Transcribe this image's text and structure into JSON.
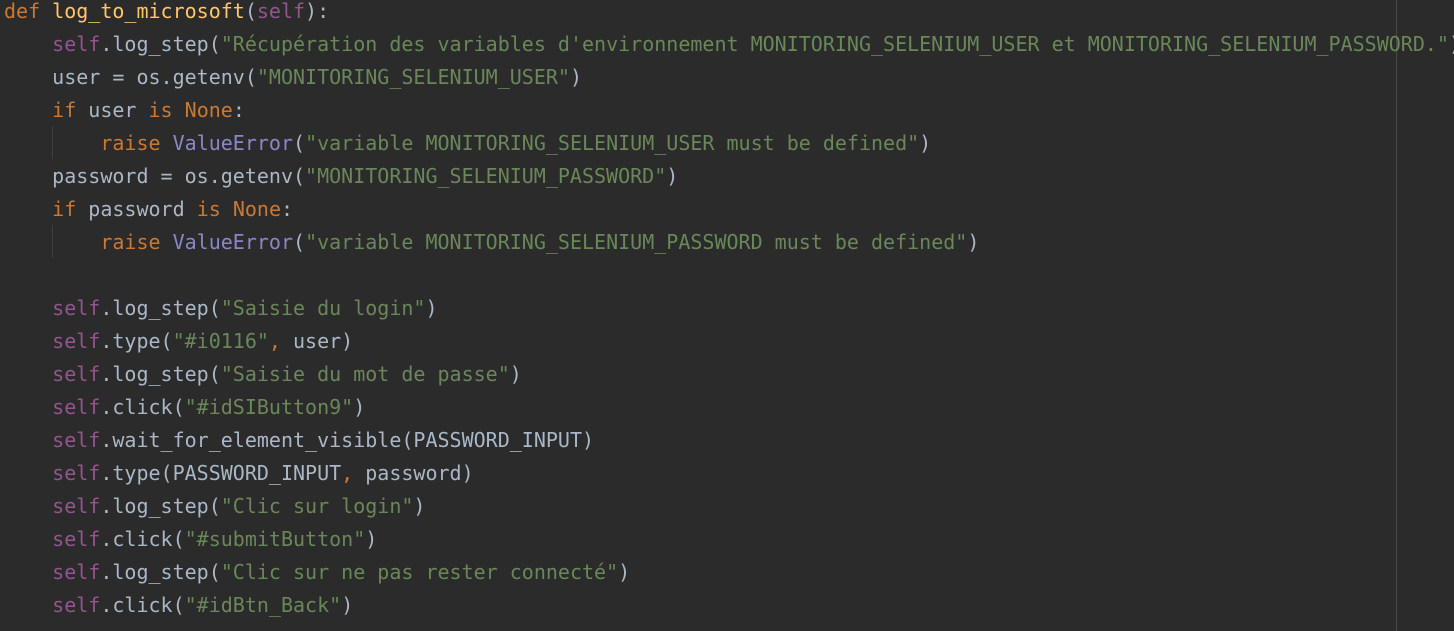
{
  "editor": {
    "language": "python",
    "colors": {
      "background": "#2b2b2b",
      "plain": "#a9b7c6",
      "keyword": "#cc7832",
      "function_name": "#ffc66d",
      "self": "#94558d",
      "string": "#6a8759",
      "builtin": "#8888c6"
    },
    "lines": [
      [
        {
          "t": "def",
          "c": "kw"
        },
        {
          "t": " ",
          "c": "plain"
        },
        {
          "t": "log_to_microsoft",
          "c": "fn"
        },
        {
          "t": "(",
          "c": "plain"
        },
        {
          "t": "self",
          "c": "self"
        },
        {
          "t": "):",
          "c": "plain"
        }
      ],
      [
        {
          "t": "    ",
          "c": "plain"
        },
        {
          "t": "self",
          "c": "self"
        },
        {
          "t": ".log_step(",
          "c": "plain"
        },
        {
          "t": "\"Récupération des variables d'environnement MONITORING_SELENIUM_USER et MONITORING_SELENIUM_PASSWORD.\"",
          "c": "str"
        },
        {
          "t": ")",
          "c": "plain"
        }
      ],
      [
        {
          "t": "    user = os.getenv(",
          "c": "plain"
        },
        {
          "t": "\"MONITORING_SELENIUM_USER\"",
          "c": "str"
        },
        {
          "t": ")",
          "c": "plain"
        }
      ],
      [
        {
          "t": "    ",
          "c": "plain"
        },
        {
          "t": "if",
          "c": "kw"
        },
        {
          "t": " user ",
          "c": "plain"
        },
        {
          "t": "is",
          "c": "kw"
        },
        {
          "t": " ",
          "c": "plain"
        },
        {
          "t": "None",
          "c": "kw"
        },
        {
          "t": ":",
          "c": "plain"
        }
      ],
      [
        {
          "t": "        ",
          "c": "plain"
        },
        {
          "t": "raise",
          "c": "kw"
        },
        {
          "t": " ",
          "c": "plain"
        },
        {
          "t": "ValueError",
          "c": "builtin"
        },
        {
          "t": "(",
          "c": "plain"
        },
        {
          "t": "\"variable MONITORING_SELENIUM_USER must be defined\"",
          "c": "str"
        },
        {
          "t": ")",
          "c": "plain"
        }
      ],
      [
        {
          "t": "    password = os.getenv(",
          "c": "plain"
        },
        {
          "t": "\"MONITORING_SELENIUM_PASSWORD\"",
          "c": "str"
        },
        {
          "t": ")",
          "c": "plain"
        }
      ],
      [
        {
          "t": "    ",
          "c": "plain"
        },
        {
          "t": "if",
          "c": "kw"
        },
        {
          "t": " password ",
          "c": "plain"
        },
        {
          "t": "is",
          "c": "kw"
        },
        {
          "t": " ",
          "c": "plain"
        },
        {
          "t": "None",
          "c": "kw"
        },
        {
          "t": ":",
          "c": "plain"
        }
      ],
      [
        {
          "t": "        ",
          "c": "plain"
        },
        {
          "t": "raise",
          "c": "kw"
        },
        {
          "t": " ",
          "c": "plain"
        },
        {
          "t": "ValueError",
          "c": "builtin"
        },
        {
          "t": "(",
          "c": "plain"
        },
        {
          "t": "\"variable MONITORING_SELENIUM_PASSWORD must be defined\"",
          "c": "str"
        },
        {
          "t": ")",
          "c": "plain"
        }
      ],
      [],
      [
        {
          "t": "    ",
          "c": "plain"
        },
        {
          "t": "self",
          "c": "self"
        },
        {
          "t": ".log_step(",
          "c": "plain"
        },
        {
          "t": "\"Saisie du login\"",
          "c": "str"
        },
        {
          "t": ")",
          "c": "plain"
        }
      ],
      [
        {
          "t": "    ",
          "c": "plain"
        },
        {
          "t": "self",
          "c": "self"
        },
        {
          "t": ".type(",
          "c": "plain"
        },
        {
          "t": "\"#i0116\"",
          "c": "str"
        },
        {
          "t": ",",
          "c": "kw"
        },
        {
          "t": " user)",
          "c": "plain"
        }
      ],
      [
        {
          "t": "    ",
          "c": "plain"
        },
        {
          "t": "self",
          "c": "self"
        },
        {
          "t": ".log_step(",
          "c": "plain"
        },
        {
          "t": "\"Saisie du mot de passe\"",
          "c": "str"
        },
        {
          "t": ")",
          "c": "plain"
        }
      ],
      [
        {
          "t": "    ",
          "c": "plain"
        },
        {
          "t": "self",
          "c": "self"
        },
        {
          "t": ".click(",
          "c": "plain"
        },
        {
          "t": "\"#idSIButton9\"",
          "c": "str"
        },
        {
          "t": ")",
          "c": "plain"
        }
      ],
      [
        {
          "t": "    ",
          "c": "plain"
        },
        {
          "t": "self",
          "c": "self"
        },
        {
          "t": ".wait_for_element_visible(PASSWORD_INPUT)",
          "c": "plain"
        }
      ],
      [
        {
          "t": "    ",
          "c": "plain"
        },
        {
          "t": "self",
          "c": "self"
        },
        {
          "t": ".type(PASSWORD_INPUT",
          "c": "plain"
        },
        {
          "t": ",",
          "c": "kw"
        },
        {
          "t": " password)",
          "c": "plain"
        }
      ],
      [
        {
          "t": "    ",
          "c": "plain"
        },
        {
          "t": "self",
          "c": "self"
        },
        {
          "t": ".log_step(",
          "c": "plain"
        },
        {
          "t": "\"Clic sur login\"",
          "c": "str"
        },
        {
          "t": ")",
          "c": "plain"
        }
      ],
      [
        {
          "t": "    ",
          "c": "plain"
        },
        {
          "t": "self",
          "c": "self"
        },
        {
          "t": ".click(",
          "c": "plain"
        },
        {
          "t": "\"#submitButton\"",
          "c": "str"
        },
        {
          "t": ")",
          "c": "plain"
        }
      ],
      [
        {
          "t": "    ",
          "c": "plain"
        },
        {
          "t": "self",
          "c": "self"
        },
        {
          "t": ".log_step(",
          "c": "plain"
        },
        {
          "t": "\"Clic sur ne pas rester connecté\"",
          "c": "str"
        },
        {
          "t": ")",
          "c": "plain"
        }
      ],
      [
        {
          "t": "    ",
          "c": "plain"
        },
        {
          "t": "self",
          "c": "self"
        },
        {
          "t": ".click(",
          "c": "plain"
        },
        {
          "t": "\"#idBtn_Back\"",
          "c": "str"
        },
        {
          "t": ")",
          "c": "plain"
        }
      ]
    ]
  }
}
